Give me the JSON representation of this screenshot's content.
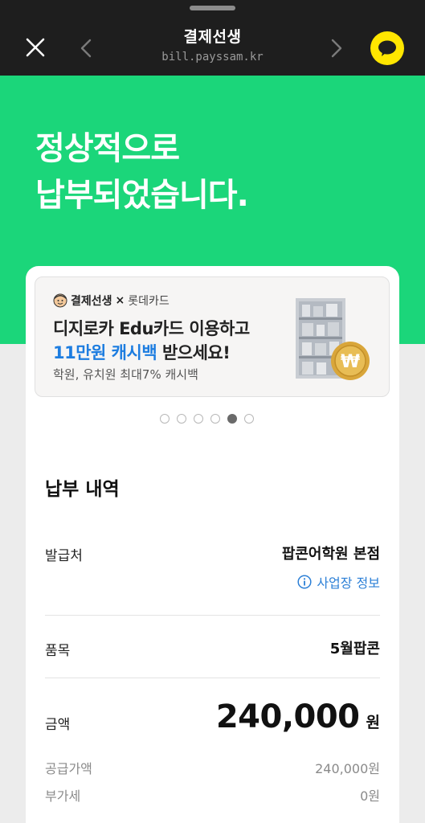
{
  "header": {
    "title": "결제선생",
    "url": "bill.payssam.kr"
  },
  "hero": {
    "line1": "정상적으로",
    "line2": "납부되었습니다."
  },
  "banner": {
    "brand_main": "결제선생",
    "brand_x": "×",
    "brand_partner": "롯데카드",
    "line1": "디지로카 Edu카드 이용하고",
    "line2_highlight": "11만원 캐시백",
    "line2_rest": " 받으세요!",
    "line3": "학원, 유치원 최대7% 캐시백"
  },
  "carousel": {
    "count": 6,
    "active_index": 4
  },
  "payment": {
    "section_title": "납부 내역",
    "issuer_label": "발급처",
    "issuer_value": "팝콘어학원 본점",
    "biz_info_link": "사업장 정보",
    "item_label": "품목",
    "item_value": "5월팝콘",
    "amount_label": "금액",
    "amount_value": "240,000",
    "amount_unit": "원",
    "supply_label": "공급가액",
    "supply_value": "240,000원",
    "vat_label": "부가세",
    "vat_value": "0원"
  },
  "colors": {
    "hero_green": "#1bd67a",
    "topbar_bg": "#1e1e1e",
    "kakao_yellow": "#ffe600",
    "link_blue": "#2b7fd6",
    "highlight_blue": "#1d7de0"
  },
  "icons": {
    "close": "close-icon",
    "back": "chevron-left-icon",
    "forward": "chevron-right-icon",
    "kakao": "kakaotalk-chat-icon",
    "info": "info-icon",
    "mascot": "mascot-icon"
  }
}
